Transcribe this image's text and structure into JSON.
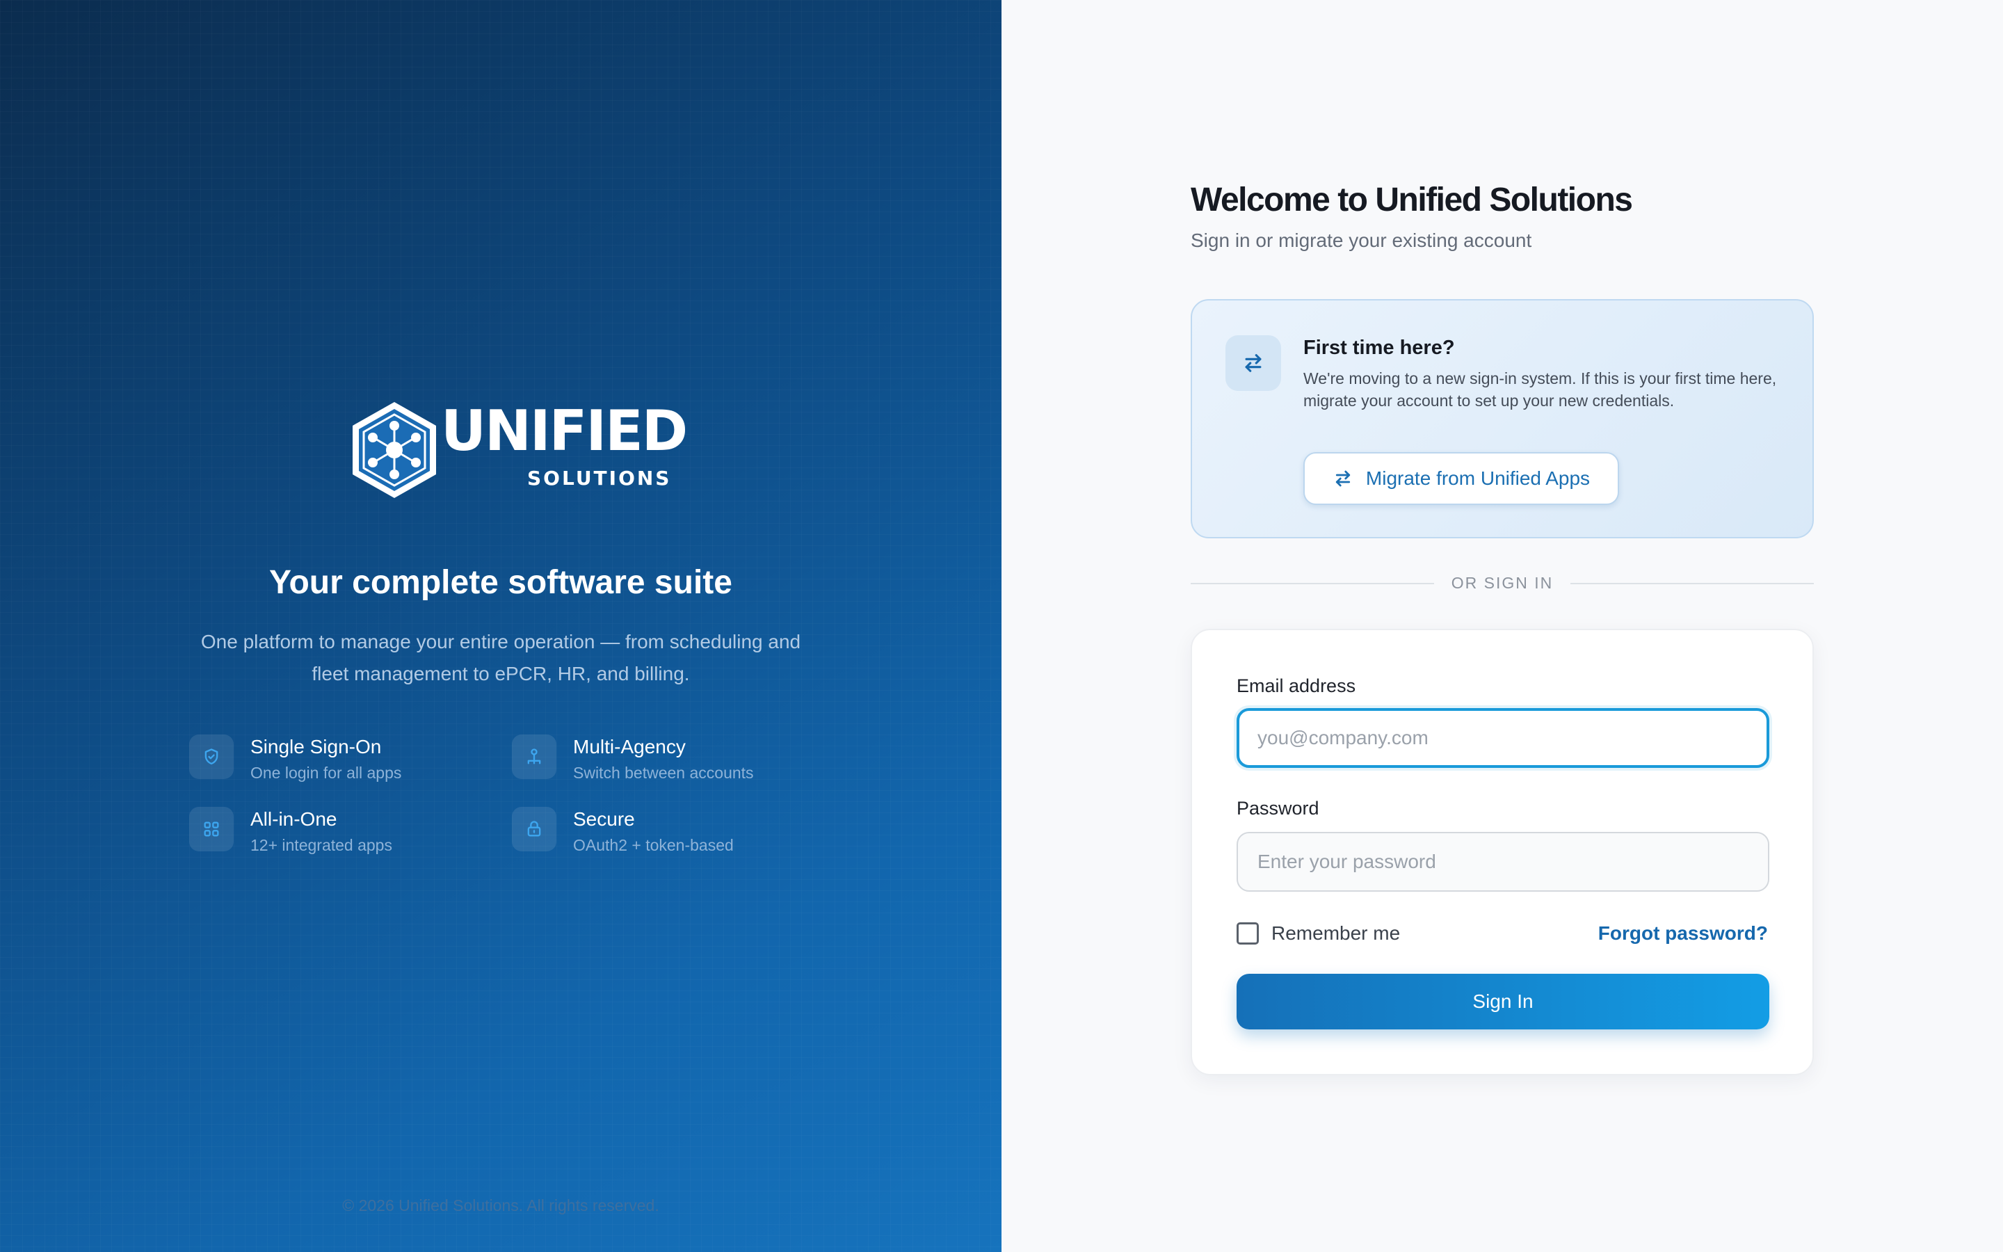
{
  "brand": {
    "logo_word": "UNIFIED",
    "logo_sub": "SOLUTIONS",
    "tagline": "Your complete software suite",
    "description": "One platform to manage your entire operation — from scheduling and fleet management to ePCR, HR, and billing.",
    "features": [
      {
        "title": "Single Sign-On",
        "subtitle": "One login for all apps",
        "icon": "shield-icon"
      },
      {
        "title": "Multi-Agency",
        "subtitle": "Switch between accounts",
        "icon": "network-icon"
      },
      {
        "title": "All-in-One",
        "subtitle": "12+ integrated apps",
        "icon": "grid-icon"
      },
      {
        "title": "Secure",
        "subtitle": "OAuth2 + token-based",
        "icon": "lock-icon"
      }
    ],
    "copyright": "© 2026 Unified Solutions. All rights reserved."
  },
  "form": {
    "title": "Welcome to Unified Solutions",
    "subtitle": "Sign in or migrate your existing account",
    "migrate": {
      "title": "First time here?",
      "text": "We're moving to a new sign-in system. If this is your first time here, migrate your account to set up your new credentials.",
      "button_label": "Migrate from Unified Apps",
      "icon": "swap-arrows-icon"
    },
    "divider_text": "OR SIGN IN",
    "email": {
      "label": "Email address",
      "value": "",
      "placeholder": "you@company.com"
    },
    "password": {
      "label": "Password",
      "value": "",
      "placeholder": "Enter your password"
    },
    "remember_label": "Remember me",
    "remember_checked": false,
    "forgot_label": "Forgot password?",
    "signin_label": "Sign In"
  },
  "colors": {
    "brand_dark": "#0b2c4e",
    "brand_blue": "#1673bd",
    "accent": "#1a9ad9",
    "link": "#1668ad",
    "button_start": "#1570b8",
    "button_end": "#139de5"
  }
}
